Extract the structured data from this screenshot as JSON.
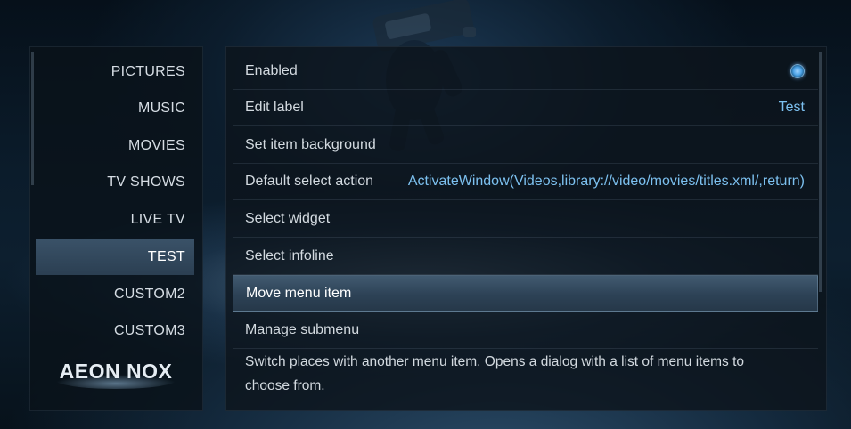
{
  "menu": {
    "items": [
      {
        "label": "PICTURES"
      },
      {
        "label": "MUSIC"
      },
      {
        "label": "MOVIES"
      },
      {
        "label": "TV SHOWS"
      },
      {
        "label": "LIVE TV"
      },
      {
        "label": "TEST",
        "selected": true
      },
      {
        "label": "CUSTOM2"
      },
      {
        "label": "CUSTOM3"
      }
    ]
  },
  "logo": {
    "text": "AEON NOX"
  },
  "settings": {
    "rows": [
      {
        "label": "Enabled",
        "control": "radio-on"
      },
      {
        "label": "Edit label",
        "value": "Test"
      },
      {
        "label": "Set item background"
      },
      {
        "label": "Default select action",
        "value": "ActivateWindow(Videos,library://video/movies/titles.xml/,return)"
      },
      {
        "label": "Select widget"
      },
      {
        "label": "Select infoline"
      },
      {
        "label": "Move menu item",
        "focused": true
      },
      {
        "label": "Manage submenu"
      }
    ],
    "description": "Switch places with another menu item. Opens a dialog with a list of menu items to choose from."
  },
  "colors": {
    "accent": "#7cc0ef",
    "selection": "#3a5268",
    "text": "#d3dae0"
  }
}
